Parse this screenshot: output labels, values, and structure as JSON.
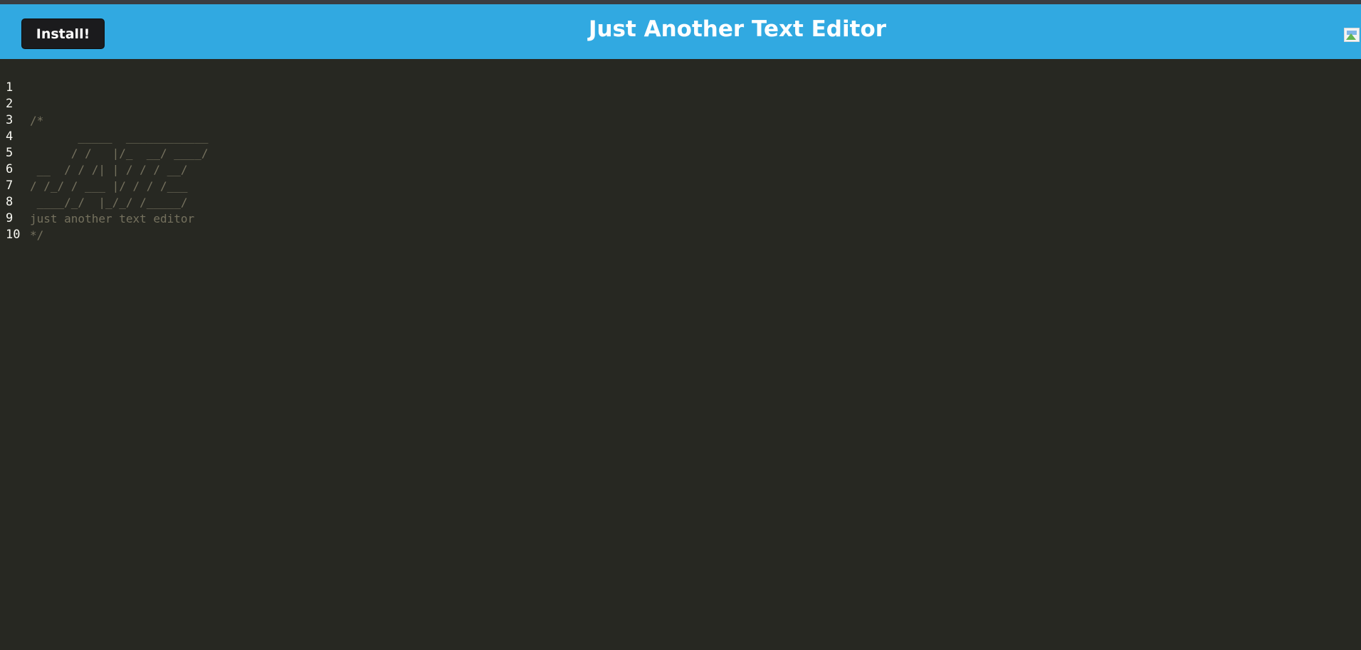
{
  "header": {
    "install_label": "Install!",
    "title": "Just Another Text Editor",
    "logo_icon": "broken-image-icon"
  },
  "editor": {
    "lines": [
      {
        "number": "1",
        "text": ""
      },
      {
        "number": "2",
        "text": "/*"
      },
      {
        "number": "3",
        "text": "       _____  ____________"
      },
      {
        "number": "4",
        "text": "      / /   |/_  __/ ____/"
      },
      {
        "number": "5",
        "text": " __  / / /| | / / / __/"
      },
      {
        "number": "6",
        "text": "/ /_/ / ___ |/ / / /___"
      },
      {
        "number": "7",
        "text": " ____/_/  |_/_/ /_____/"
      },
      {
        "number": "8",
        "text": "just another text editor"
      },
      {
        "number": "9",
        "text": "*/"
      },
      {
        "number": "10",
        "text": ""
      }
    ]
  },
  "colors": {
    "header_bg": "#31a9e1",
    "editor_bg": "#272822",
    "comment": "#75715e",
    "gutter_text": "#f8f8f2",
    "button_bg": "#1b1b1d"
  }
}
